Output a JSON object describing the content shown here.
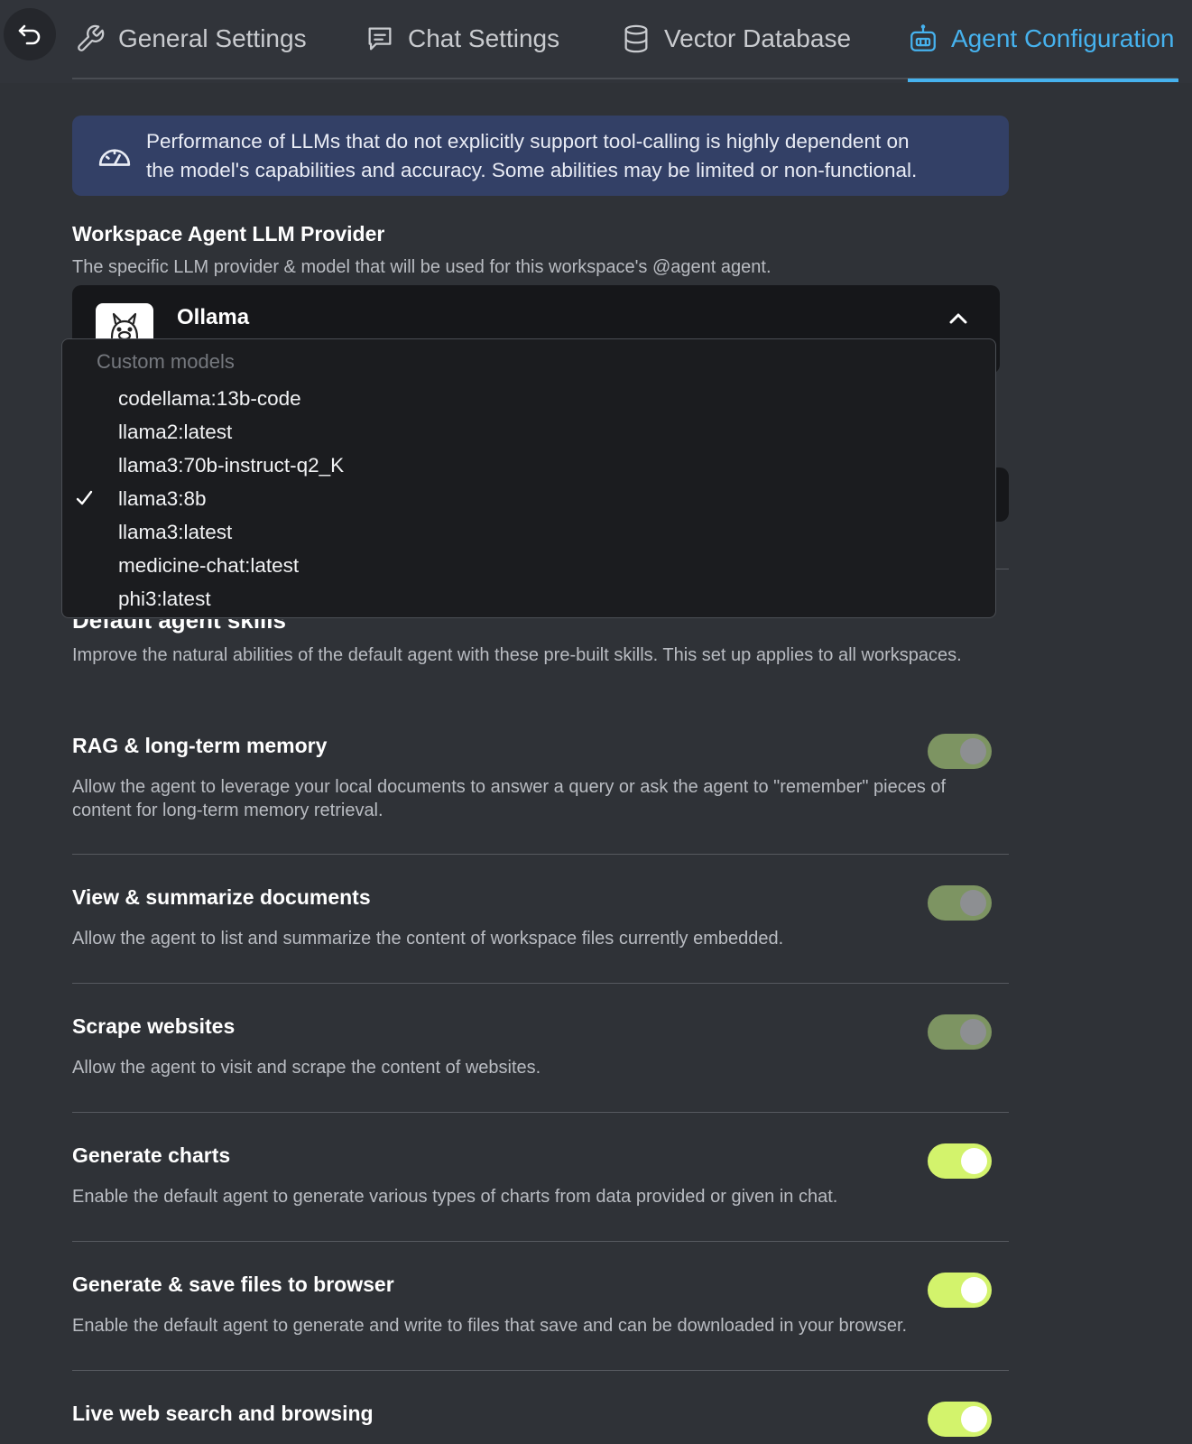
{
  "tabs": [
    {
      "label": "General Settings",
      "icon": "wrench-icon"
    },
    {
      "label": "Chat Settings",
      "icon": "message-square-icon"
    },
    {
      "label": "Vector Database",
      "icon": "database-icon"
    },
    {
      "label": "Agent Configuration",
      "icon": "robot-icon",
      "active": true
    }
  ],
  "notice": {
    "line1": "Performance of LLMs that do not explicitly support tool-calling is highly dependent on",
    "line2": "the model's capabilities and accuracy. Some abilities may be limited or non-functional.",
    "icon": "gauge-icon"
  },
  "provider_section": {
    "title": "Workspace Agent LLM Provider",
    "description": "The specific LLM provider & model that will be used for this workspace's @agent agent.",
    "selected_provider": "Ollama",
    "provider_icon": "ollama-logo"
  },
  "model_dropdown": {
    "group_label": "Custom models",
    "selected": "llama3:8b",
    "items": [
      "codellama:13b-code",
      "llama2:latest",
      "llama3:70b-instruct-q2_K",
      "llama3:8b",
      "llama3:latest",
      "medicine-chat:latest",
      "phi3:latest"
    ]
  },
  "skills_section": {
    "title": "Default agent skills",
    "description": "Improve the natural abilities of the default agent with these pre-built skills. This set up applies to all workspaces."
  },
  "skills": [
    {
      "title": "RAG & long-term memory",
      "description": "Allow the agent to leverage your local documents to answer a query or ask the agent to \"remember\" pieces of content for long-term memory retrieval.",
      "enabled": false
    },
    {
      "title": "View & summarize documents",
      "description": "Allow the agent to list and summarize the content of workspace files currently embedded.",
      "enabled": false
    },
    {
      "title": "Scrape websites",
      "description": "Allow the agent to visit and scrape the content of websites.",
      "enabled": false
    },
    {
      "title": "Generate charts",
      "description": "Enable the default agent to generate various types of charts from data provided or given in chat.",
      "enabled": true
    },
    {
      "title": "Generate & save files to browser",
      "description": "Enable the default agent to generate and write to files that save and can be downloaded in your browser.",
      "enabled": true
    },
    {
      "title": "Live web search and browsing",
      "description": "",
      "enabled": true
    }
  ],
  "colors": {
    "accent": "#46b2ee",
    "toggle_on": "#d3f36c",
    "toggle_off": "#7d9462",
    "notice_bg": "#334066"
  }
}
